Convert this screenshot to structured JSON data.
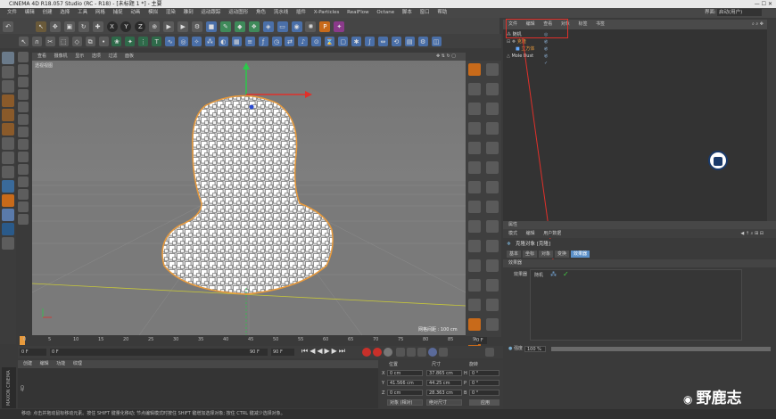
{
  "window": {
    "title": "CINEMA 4D R18.057 Studio (RC - R18) - [未标题 1 *] - 主要"
  },
  "menu": [
    "文件",
    "编辑",
    "创建",
    "选择",
    "工具",
    "网格",
    "捕捉",
    "动画",
    "模拟",
    "渲染",
    "雕刻",
    "运动跟踪",
    "运动图形",
    "角色",
    "流水线",
    "插件",
    "X-Particles",
    "RealFlow",
    "Octane",
    "脚本",
    "窗口",
    "帮助"
  ],
  "layout": {
    "label": "界面:",
    "value": "启动(用户)"
  },
  "viewport": {
    "menu": [
      "查看",
      "摄像机",
      "显示",
      "选项",
      "过滤",
      "面板"
    ],
    "label": "透视视图",
    "grid_spacing": "网格间距 : 100 cm"
  },
  "timeline": {
    "ticks": [
      "0",
      "5",
      "10",
      "15",
      "20",
      "25",
      "30",
      "35",
      "40",
      "45",
      "50",
      "55",
      "60",
      "65",
      "70",
      "75",
      "80",
      "85",
      "90"
    ],
    "end_label": "0 F"
  },
  "playback": {
    "current_frame": "0 F",
    "start": "0 F",
    "end": "90 F",
    "max": "90 F"
  },
  "material_manager": {
    "menu": [
      "创建",
      "编辑",
      "功能",
      "纹理"
    ]
  },
  "coordinates": {
    "headers": [
      "位置",
      "尺寸",
      "旋转"
    ],
    "rows": [
      {
        "axis": "X",
        "pos": "0 cm",
        "size": "37.865 cm",
        "rot_label": "H",
        "rot": "0 °"
      },
      {
        "axis": "Y",
        "pos": "41.566 cm",
        "size": "44.25 cm",
        "rot_label": "P",
        "rot": "0 °"
      },
      {
        "axis": "Z",
        "pos": "0 cm",
        "size": "28.363 cm",
        "rot_label": "B",
        "rot": "0 °"
      }
    ],
    "mode_object": "对象 (相对)",
    "mode_size": "绝对尺寸",
    "apply": "应用"
  },
  "object_manager": {
    "menu": [
      "文件",
      "编辑",
      "查看",
      "对象",
      "标签",
      "书签"
    ],
    "objects": [
      {
        "name": "随机",
        "color": "#dcdcdc"
      },
      {
        "name": "克隆",
        "color": "#e89a3c"
      },
      {
        "name": "立方体",
        "color": "#e89a3c"
      },
      {
        "name": "Mole Bust",
        "color": "#dcdcdc"
      }
    ]
  },
  "attributes": {
    "header": "属性",
    "menu": [
      "模式",
      "编辑",
      "用户数据"
    ],
    "object_title": "克隆对象 [克隆]",
    "tabs": [
      "基本",
      "坐标",
      "对象",
      "变换",
      "效果器"
    ],
    "active_tab": "效果器",
    "section": "效果器",
    "effectors_label": "效果器",
    "effector_item": "随机",
    "strength_label": "强度",
    "strength_value": "100 %"
  },
  "status": "移动: 点击并拖动鼠标移动元素。按住 SHIFT 键量化移动; 节点编辑模式时按住 SHIFT 键增加选择对象; 按住 CTRL 键减少选择对象。",
  "watermark": "野鹿志",
  "brand": "MAXON CINEMA 4D",
  "colors": {
    "accent_orange": "#e89a3c",
    "active_tab": "#5a8fc8",
    "annotation_red": "#e0302a"
  }
}
